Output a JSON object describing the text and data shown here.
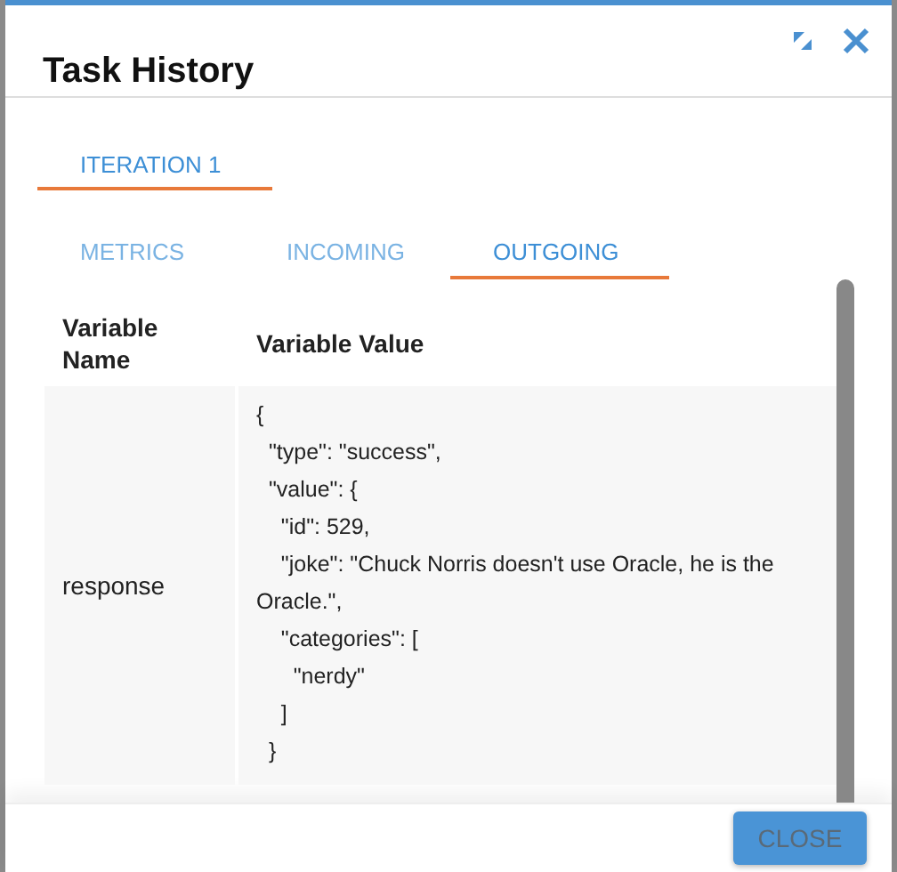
{
  "dialog": {
    "title": "Task History"
  },
  "iteration_tabs": [
    {
      "label": "ITERATION 1",
      "selected": true
    }
  ],
  "detail_tabs": [
    {
      "label": "METRICS",
      "selected": false
    },
    {
      "label": "INCOMING",
      "selected": false
    },
    {
      "label": "OUTGOING",
      "selected": true
    }
  ],
  "table": {
    "columns": [
      "Variable Name",
      "Variable Value"
    ],
    "rows": [
      {
        "name": "response",
        "value_lines": [
          "{",
          "  \"type\": \"success\",",
          "  \"value\": {",
          "    \"id\": 529,",
          "    \"joke\": \"Chuck Norris doesn't use Oracle, he is the Oracle.\",",
          "    \"categories\": [",
          "      \"nerdy\"",
          "    ]",
          "  }"
        ]
      }
    ]
  },
  "buttons": [
    "CLOSE"
  ]
}
